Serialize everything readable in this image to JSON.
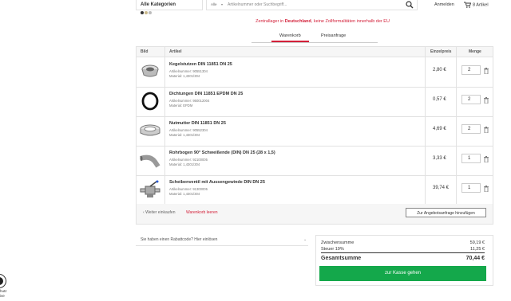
{
  "header": {
    "category_label": "Alle Kategorien",
    "search_scope": "Alle",
    "search_placeholder": "Artikelnummer oder Suchbegriff...",
    "login_label": "Anmelden",
    "cart_label": "8 Artikel"
  },
  "notice": {
    "prefix": "Zentrallager in ",
    "country": "Deutschland",
    "suffix": ", keine Zollformalitäten innerhalb der EU"
  },
  "tabs": [
    {
      "label": "Warenkorb",
      "active": true
    },
    {
      "label": "Preisanfrage",
      "active": false
    }
  ],
  "table": {
    "headers": {
      "image": "Bild",
      "article": "Artikel",
      "unit_price": "Einzelpreis",
      "quantity": "Menge"
    },
    "rows": [
      {
        "name": "Kegelstutzen DIN 11851 DN 25",
        "article_no": "Artikelnummer: 90551304",
        "material": "Material: 1,4301/304",
        "price": "2,80 €",
        "qty": "2",
        "icon": "cone-nozzle-icon"
      },
      {
        "name": "Dichtungen DIN 11851 EPDM DN 25",
        "article_no": "Artikelnummer: 950012004",
        "material": "Material: EPDM",
        "price": "0,57 €",
        "qty": "2",
        "icon": "gasket-ring-icon"
      },
      {
        "name": "Nutmutter DIN 11851 DN 25",
        "article_no": "Artikelnummer: 90552304",
        "material": "Material: 1,4301/304",
        "price": "4,69 €",
        "qty": "2",
        "icon": "groove-nut-icon"
      },
      {
        "name": "Rohrbogen 90° Schweißende (DIN) DN 25 (28 x 1,5)",
        "article_no": "Artikelnummer: 92100005",
        "material": "Material: 1,4301/304",
        "price": "3,33 €",
        "qty": "1",
        "icon": "pipe-bend-icon"
      },
      {
        "name": "Scheibenventil mit Aussengewinde DIN DN 25",
        "article_no": "Artikelnummer: 91300005",
        "material": "Material: 1,4301/304",
        "price": "39,74 €",
        "qty": "1",
        "icon": "disc-valve-icon"
      }
    ],
    "footer": {
      "continue_label": "Weiter einkaufen",
      "empty_label": "Warenkorb leeren",
      "add_quote_label": "Zur Angebotsanfrage hinzufügen"
    }
  },
  "coupon": {
    "label": "Sie haben einen Rabattcode? Hier einlösen"
  },
  "summary": {
    "subtotal_label": "Zwischensumme",
    "subtotal_value": "59,19 €",
    "tax_label": "Steuer 19%",
    "tax_value": "11,25 €",
    "total_label": "Gesamtsumme",
    "total_value": "70,44 €",
    "checkout_label": "zur Kasse gehen"
  },
  "seal": {
    "line1": "hutz",
    "line2": "ive"
  },
  "colors": {
    "accent": "#d3213a",
    "checkout": "#14a84b",
    "header_bg": "#f6f6f6"
  }
}
